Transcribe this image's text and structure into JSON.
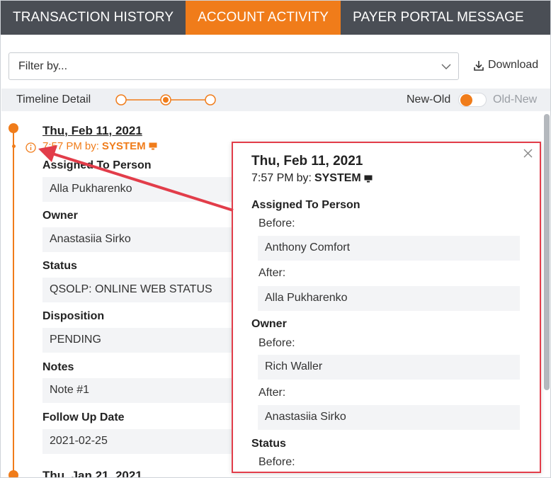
{
  "tabs": [
    {
      "label": "TRANSACTION HISTORY",
      "active": false
    },
    {
      "label": "ACCOUNT ACTIVITY",
      "active": true
    },
    {
      "label": "PAYER PORTAL MESSAGE",
      "active": false
    }
  ],
  "filter": {
    "placeholder": "Filter by..."
  },
  "download": {
    "label": "Download",
    "icon": "download-icon"
  },
  "timeline_bar": {
    "label": "Timeline Detail",
    "detail_level": 2,
    "detail_levels": 3,
    "sort_left": "New-Old",
    "sort_right": "Old-New",
    "sort_selected": "New-Old"
  },
  "entry": {
    "date": "Thu, Feb 11, 2021",
    "time": "7:57 PM",
    "by_label": "by:",
    "by": "SYSTEM",
    "fields": [
      {
        "label": "Assigned To Person",
        "value": "Alla Pukharenko"
      },
      {
        "label": "Owner",
        "value": "Anastasiia Sirko"
      },
      {
        "label": "Status",
        "value": "QSOLP: ONLINE WEB STATUS"
      },
      {
        "label": "Disposition",
        "value": "PENDING"
      },
      {
        "label": "Notes",
        "value": "Note #1"
      },
      {
        "label": "Follow Up Date",
        "value": "2021-02-25"
      }
    ]
  },
  "next_entry": {
    "date": "Thu, Jan 21, 2021"
  },
  "popover": {
    "date": "Thu, Feb 11, 2021",
    "time": "7:57 PM",
    "by_label": "by:",
    "by": "SYSTEM",
    "before_label": "Before:",
    "after_label": "After:",
    "changes": [
      {
        "label": "Assigned To Person",
        "before": "Anthony Comfort",
        "after": "Alla Pukharenko"
      },
      {
        "label": "Owner",
        "before": "Rich Waller",
        "after": "Anastasiia Sirko"
      },
      {
        "label": "Status"
      }
    ]
  },
  "colors": {
    "accent": "#f07c1a",
    "tabbar": "#4a4e55",
    "highlight": "#e23d4a"
  }
}
